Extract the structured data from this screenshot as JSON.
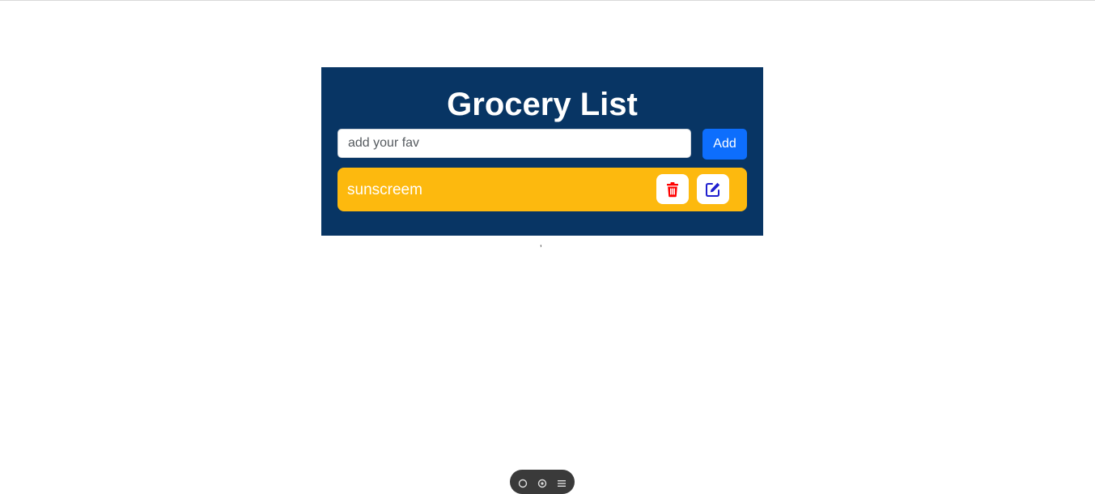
{
  "app": {
    "title": "Grocery List"
  },
  "form": {
    "input_value": "",
    "input_placeholder": "add your fav",
    "add_label": "Add"
  },
  "items": [
    {
      "label": "sunscreem",
      "delete_icon": "trash-icon",
      "edit_icon": "edit-icon"
    }
  ],
  "stray_text": "’",
  "floating_toolbar": {
    "icons": [
      "zoom-icon",
      "screenshot-icon",
      "menu-icon"
    ]
  },
  "colors": {
    "card_background": "#083564",
    "item_background": "#fdb90e",
    "add_button": "#0d6efd",
    "delete_icon": "#ff0000",
    "edit_icon": "#1f1fcf",
    "text_light": "#ffffff"
  }
}
